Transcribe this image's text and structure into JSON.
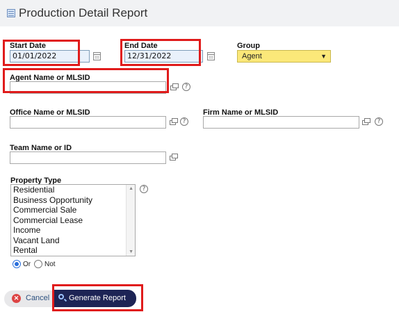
{
  "header": {
    "title": "Production Detail Report",
    "icon": "report-icon"
  },
  "form": {
    "start_date": {
      "label": "Start Date",
      "value": "01/01/2022"
    },
    "end_date": {
      "label": "End Date",
      "value": "12/31/2022"
    },
    "group": {
      "label": "Group",
      "selected": "Agent"
    },
    "agent": {
      "label": "Agent Name or MLSID",
      "value": ""
    },
    "office": {
      "label": "Office Name or MLSID",
      "value": ""
    },
    "firm": {
      "label": "Firm Name or MLSID",
      "value": ""
    },
    "team": {
      "label": "Team Name or ID",
      "value": ""
    },
    "property_type": {
      "label": "Property Type",
      "options": [
        "Residential",
        "Business Opportunity",
        "Commercial Sale",
        "Commercial Lease",
        "Income",
        "Vacant Land",
        "Rental"
      ]
    },
    "logic": {
      "or_label": "Or",
      "not_label": "Not",
      "selected": "Or"
    }
  },
  "actions": {
    "cancel_label": "Cancel",
    "generate_label": "Generate Report"
  },
  "colors": {
    "highlight": "#e01b1b",
    "group_select_bg": "#fbe879",
    "generate_bg": "#1d2455",
    "date_bg": "#e9f1fb"
  }
}
